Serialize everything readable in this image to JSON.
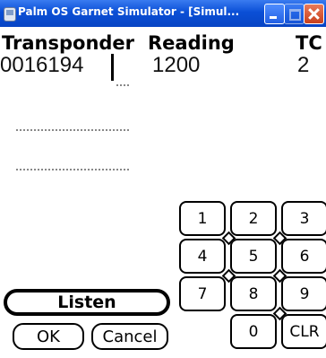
{
  "window": {
    "title": "Palm OS Garnet Simulator - [Simul..."
  },
  "header": {
    "transponder": "Transponder",
    "reading": "Reading",
    "tc": "TC"
  },
  "fields": {
    "transponder": "0016194",
    "reading": "1200",
    "tc": "2"
  },
  "keypad": {
    "keys": [
      "1",
      "2",
      "3",
      "4",
      "5",
      "6",
      "7",
      "8",
      "9",
      "0",
      "CLR"
    ]
  },
  "buttons": {
    "listen": "Listen",
    "ok": "OK",
    "cancel": "Cancel"
  }
}
